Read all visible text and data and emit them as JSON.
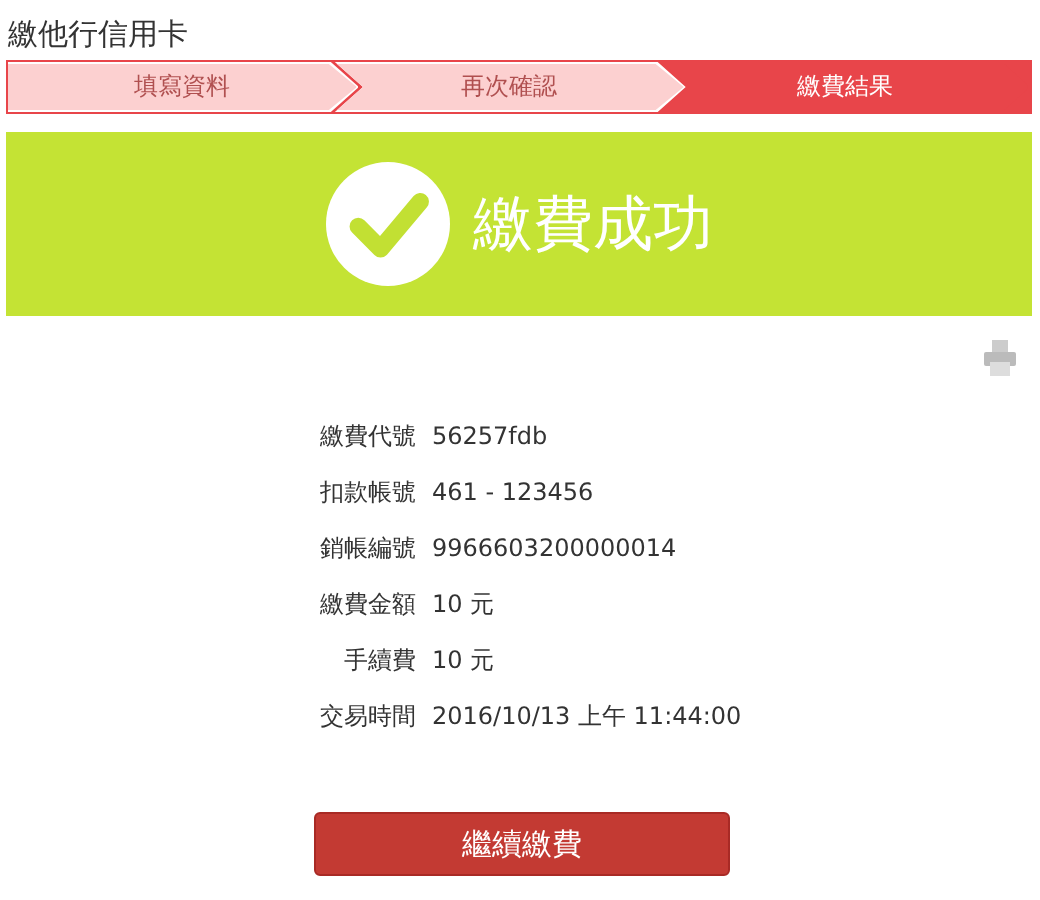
{
  "page_title": "繳他行信用卡",
  "steps": [
    {
      "label": "填寫資料",
      "selected": false
    },
    {
      "label": "再次確認",
      "selected": false
    },
    {
      "label": "繳費結果",
      "selected": true
    }
  ],
  "result_banner": {
    "message": "繳費成功"
  },
  "details": [
    {
      "label": "繳費代號",
      "value": "56257fdb"
    },
    {
      "label": "扣款帳號",
      "value": "461 - 123456"
    },
    {
      "label": "銷帳編號",
      "value": "9966603200000014"
    },
    {
      "label": "繳費金額",
      "value": "10 元"
    },
    {
      "label": "手續費",
      "value": "10 元"
    },
    {
      "label": "交易時間",
      "value": "2016/10/13 上午 11:44:00"
    }
  ],
  "buttons": [
    "繼續繳費"
  ]
}
